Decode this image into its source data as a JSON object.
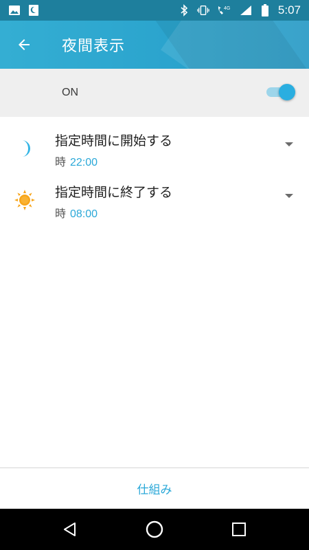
{
  "status_bar": {
    "time": "5:07",
    "network": "4G",
    "left_icons": [
      "image-icon",
      "night-mode-icon"
    ],
    "right_icons": [
      "bluetooth-icon",
      "vibrate-icon",
      "volte-icon",
      "signal-icon",
      "battery-icon"
    ]
  },
  "app_bar": {
    "title": "夜間表示",
    "back_icon": "back-arrow-icon"
  },
  "master": {
    "label": "ON",
    "enabled": true
  },
  "schedule": {
    "start": {
      "title": "指定時間に開始する",
      "time_prefix": "時",
      "time": "22:00",
      "icon": "moon-icon"
    },
    "end": {
      "title": "指定時間に終了する",
      "time_prefix": "時",
      "time": "08:00",
      "icon": "sun-icon"
    }
  },
  "footer": {
    "link_label": "仕組み"
  },
  "nav_bar": {
    "buttons": [
      "back-nav-icon",
      "home-nav-icon",
      "recents-nav-icon"
    ]
  },
  "colors": {
    "accent": "#2aa8d8",
    "app_bar": "#2ea6d0",
    "status_bar": "#1e7f9d",
    "master_bg": "#efefef",
    "moon": "#33b5e5",
    "sun": "#f7a51b"
  }
}
